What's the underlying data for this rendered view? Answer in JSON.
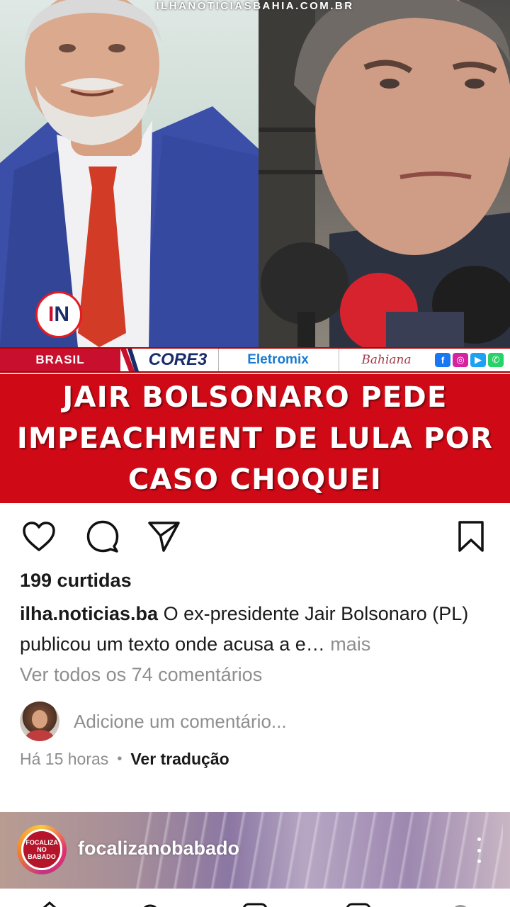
{
  "post": {
    "watermark": "ILHANOTICIASBAHIA.COM.BR",
    "logo_text_i": "I",
    "logo_text_n": "N",
    "tag": "BRASIL",
    "sponsors": [
      "CORE3",
      "Eletromix",
      "Bahiana"
    ],
    "social": [
      "f",
      "◎",
      "▶",
      "✆"
    ],
    "headline": "JAIR BOLSONARO PEDE\nIMPEACHMENT DE LULA POR\nCASO CHOQUEI"
  },
  "actions": {
    "like": "heart-icon",
    "comment": "comment-icon",
    "share": "send-icon",
    "save": "bookmark-icon"
  },
  "likes": "199 curtidas",
  "caption": {
    "username": "ilha.noticias.ba",
    "text": " O ex-presidente Jair Bolsonaro (PL) publicou um texto onde acusa a e…",
    "more": " mais"
  },
  "view_comments": "Ver todos os 74 comentários",
  "comment_placeholder": "Adicione um comentário...",
  "meta": {
    "time": "Há 15 horas",
    "separator": "•",
    "translate": "Ver tradução"
  },
  "next_post": {
    "avatar_text": "FOCALIZA NO BABADO",
    "username": "focalizanobabado"
  },
  "colors": {
    "headline_red": "#cf0a16",
    "brand_red": "#c8102e",
    "muted_text": "#8e8e8e"
  }
}
